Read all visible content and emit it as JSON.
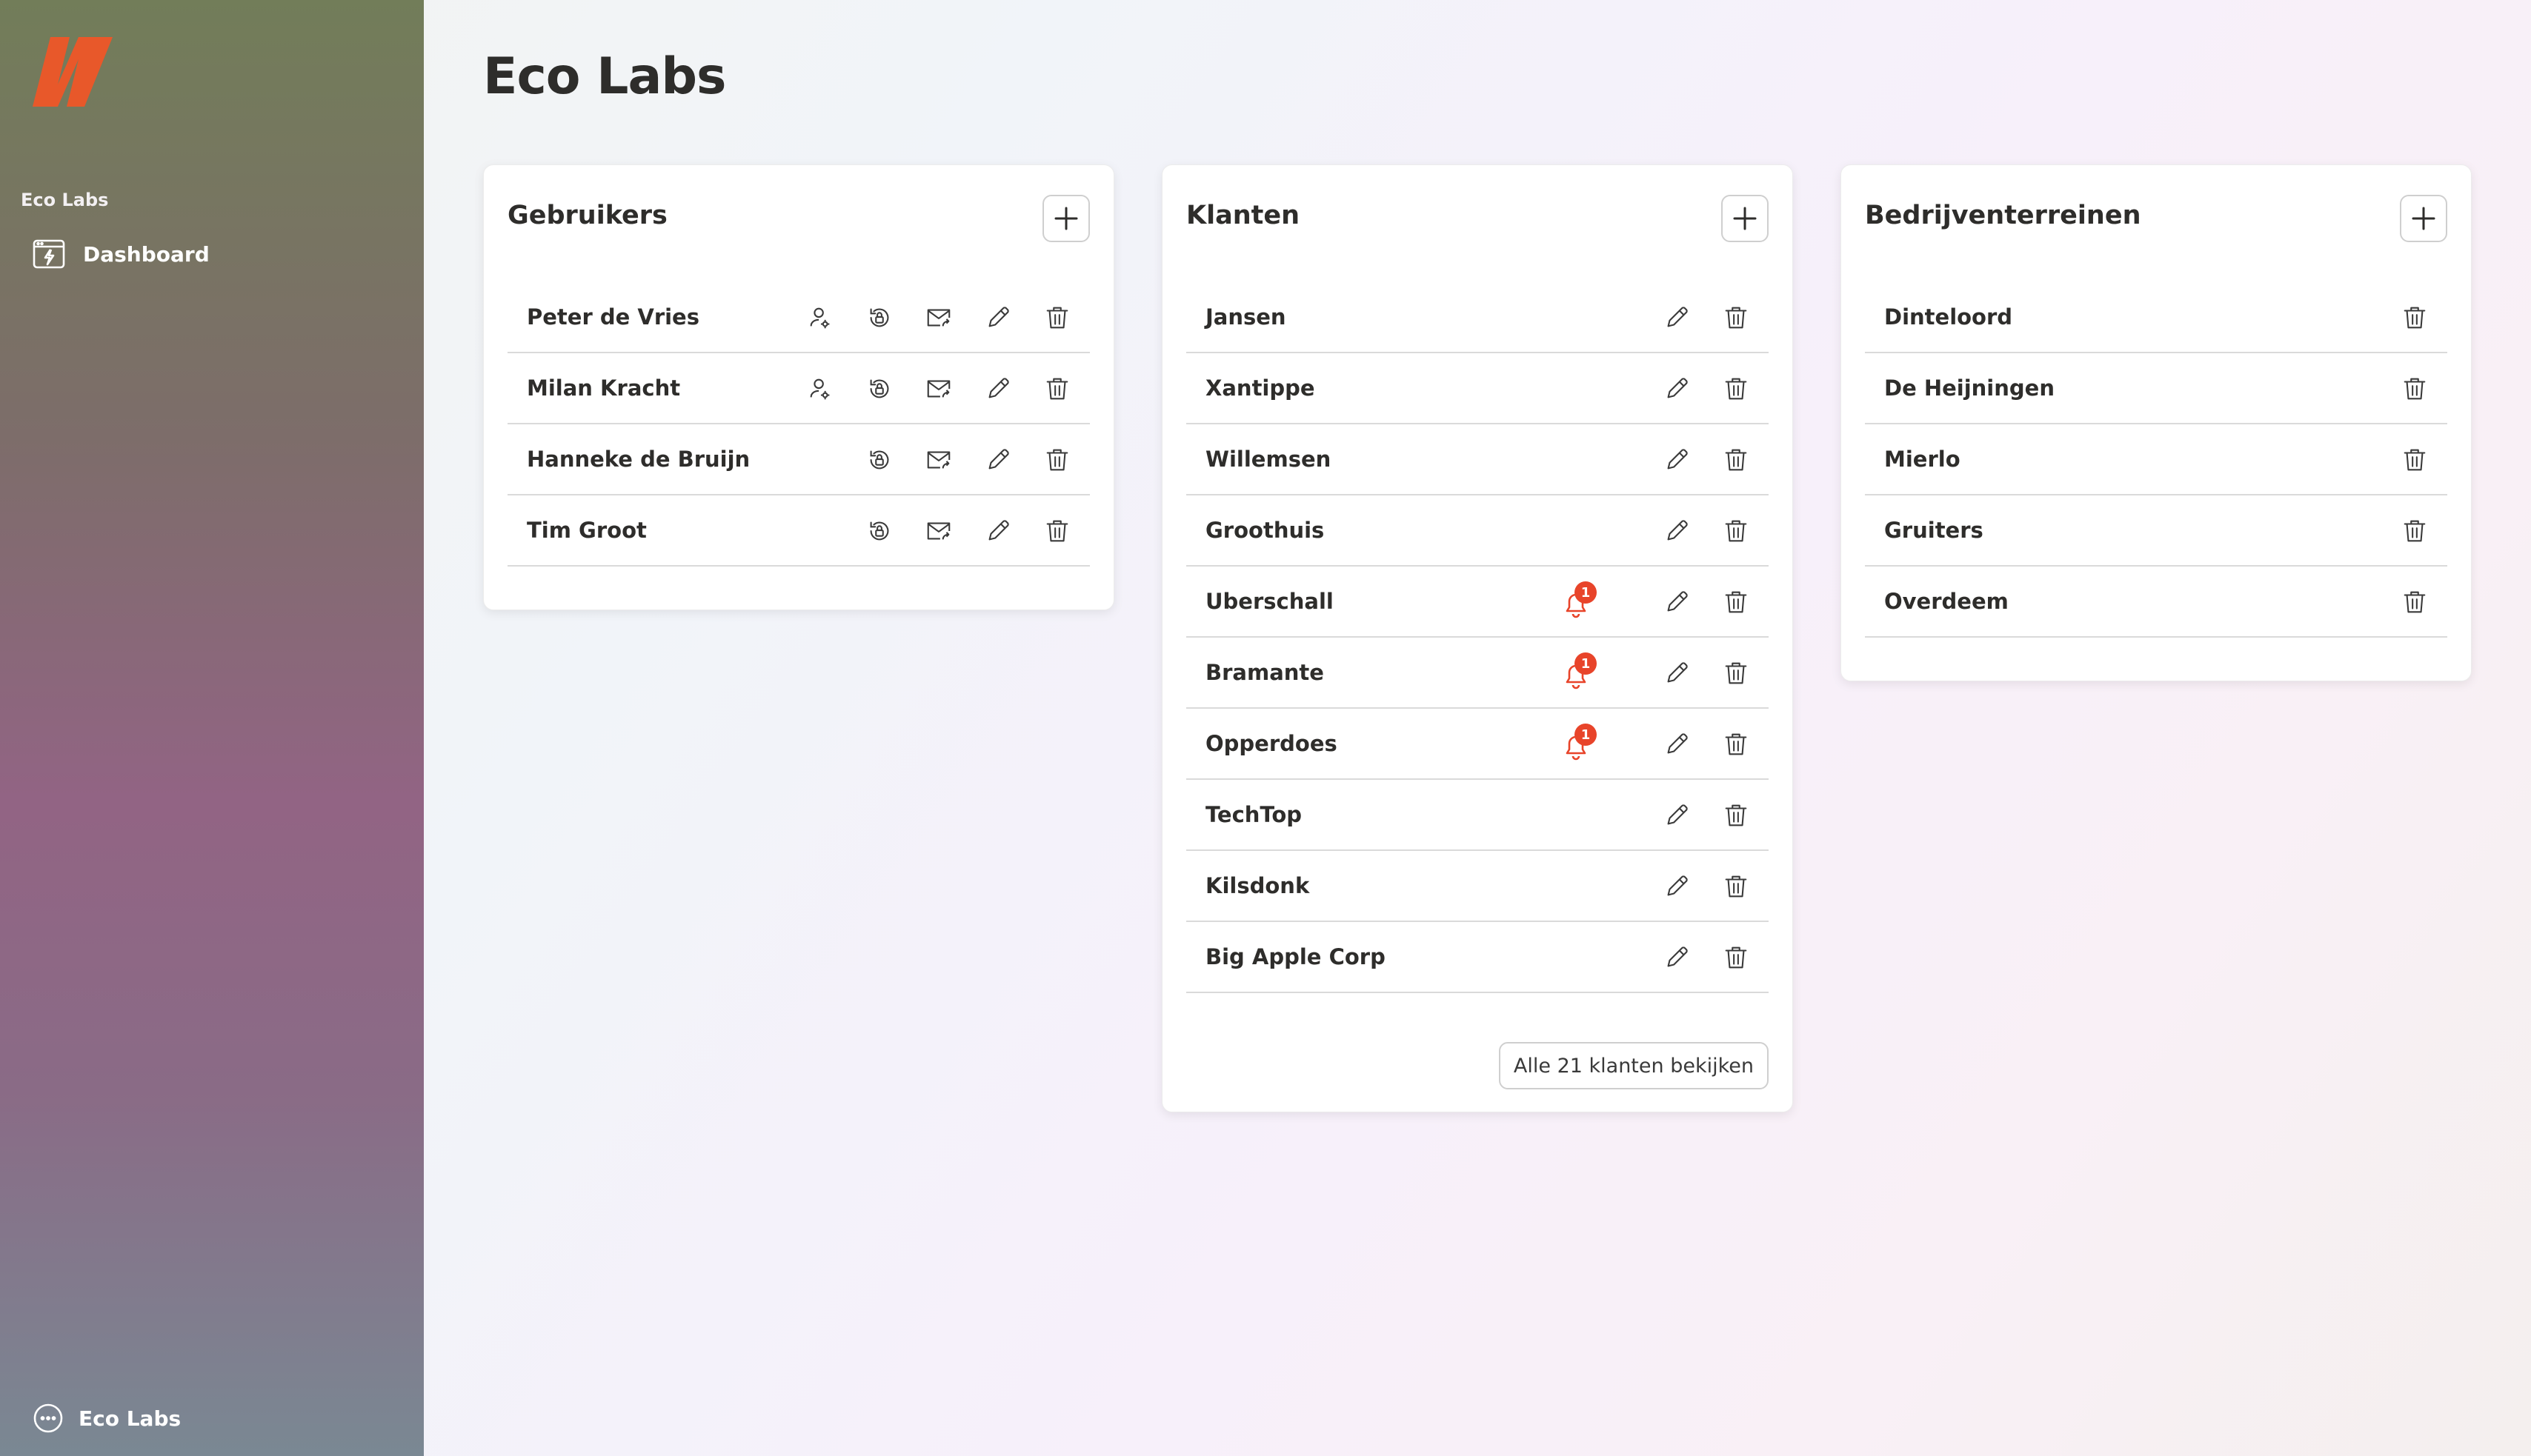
{
  "brand": {
    "accent": "#e8582a",
    "badge_color": "#e8442a"
  },
  "sidebar": {
    "org_label": "Eco Labs",
    "nav": [
      {
        "label": "Dashboard",
        "icon": "dashboard-icon"
      }
    ],
    "account_label": "Eco Labs"
  },
  "page": {
    "title": "Eco Labs"
  },
  "users": {
    "title": "Gebruikers",
    "rows": [
      {
        "name": "Peter de Vries"
      },
      {
        "name": "Milan Kracht"
      },
      {
        "name": "Hanneke de Bruijn"
      },
      {
        "name": "Tim Groot"
      }
    ]
  },
  "clients": {
    "title": "Klanten",
    "rows": [
      {
        "name": "Jansen"
      },
      {
        "name": "Xantippe"
      },
      {
        "name": "Willemsen"
      },
      {
        "name": "Groothuis"
      },
      {
        "name": "Uberschall",
        "notifications": "1"
      },
      {
        "name": "Bramante",
        "notifications": "1"
      },
      {
        "name": "Opperdoes",
        "notifications": "1"
      },
      {
        "name": "TechTop"
      },
      {
        "name": "Kilsdonk"
      },
      {
        "name": "Big Apple Corp"
      }
    ],
    "view_all_label": "Alle 21 klanten bekijken"
  },
  "sites": {
    "title": "Bedrijventerreinen",
    "rows": [
      {
        "name": "Dinteloord"
      },
      {
        "name": "De Heijningen"
      },
      {
        "name": "Mierlo"
      },
      {
        "name": "Gruiters"
      },
      {
        "name": "Overdeem"
      }
    ]
  }
}
